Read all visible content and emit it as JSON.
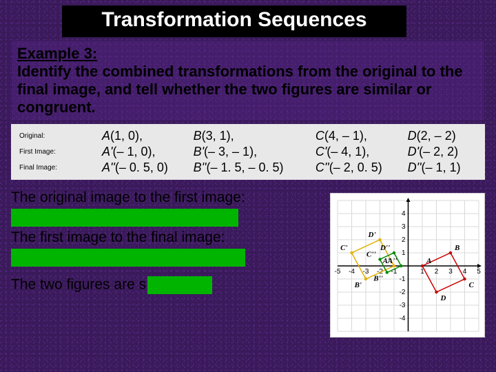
{
  "title": "Transformation Sequences",
  "prompt": {
    "heading": "Example 3:",
    "text": "Identify the combined transformations from the original to the final image, and tell whether the two figures are similar or congruent."
  },
  "coords": {
    "rows": [
      {
        "label": "Original:",
        "cells": [
          "A(1, 0),",
          "B(3, 1),",
          "C(4, – 1),",
          "D(2, – 2)"
        ]
      },
      {
        "label": "First Image:",
        "cells": [
          "A'(– 1, 0),",
          "B'(– 3, – 1),",
          "C'(– 4, 1),",
          "D'(– 2, 2)"
        ]
      },
      {
        "label": "Final Image:",
        "cells": [
          "A''(– 0. 5, 0)",
          "B''(– 1. 5, – 0. 5)",
          "C''(– 2, 0. 5)",
          "D''(– 1, 1)"
        ]
      }
    ],
    "prefixes": [
      "A",
      "B",
      "C",
      "D"
    ]
  },
  "body": {
    "line1": "The original image to the first image:",
    "line2": "The first image to the final image:",
    "line3_a": "The two figures are ",
    "line3_b": "s"
  },
  "chart_data": {
    "type": "scatter",
    "title": "",
    "xlabel": "",
    "ylabel": "",
    "xlim": [
      -5,
      5
    ],
    "ylim": [
      -5,
      5
    ],
    "grid": true,
    "x_ticks": [
      -5,
      -4,
      -3,
      -2,
      -1,
      1,
      2,
      3,
      4,
      5
    ],
    "y_ticks": [
      -4,
      -3,
      -2,
      -1,
      1,
      2,
      3,
      4
    ],
    "series": [
      {
        "name": "Original",
        "color": "#c00000",
        "labels": [
          "A",
          "B",
          "C",
          "D"
        ],
        "points": [
          [
            1,
            0
          ],
          [
            3,
            1
          ],
          [
            4,
            -1
          ],
          [
            2,
            -2
          ]
        ]
      },
      {
        "name": "First Image",
        "color": "#e0b000",
        "labels": [
          "A'",
          "B'",
          "C'",
          "D'"
        ],
        "points": [
          [
            -1,
            0
          ],
          [
            -3,
            -1
          ],
          [
            -4,
            1
          ],
          [
            -2,
            2
          ]
        ]
      },
      {
        "name": "Final Image",
        "color": "#008800",
        "labels": [
          "A''",
          "B''",
          "C''",
          "D''"
        ],
        "points": [
          [
            -0.5,
            0
          ],
          [
            -1.5,
            -0.5
          ],
          [
            -2,
            0.5
          ],
          [
            -1,
            1
          ]
        ]
      }
    ]
  }
}
